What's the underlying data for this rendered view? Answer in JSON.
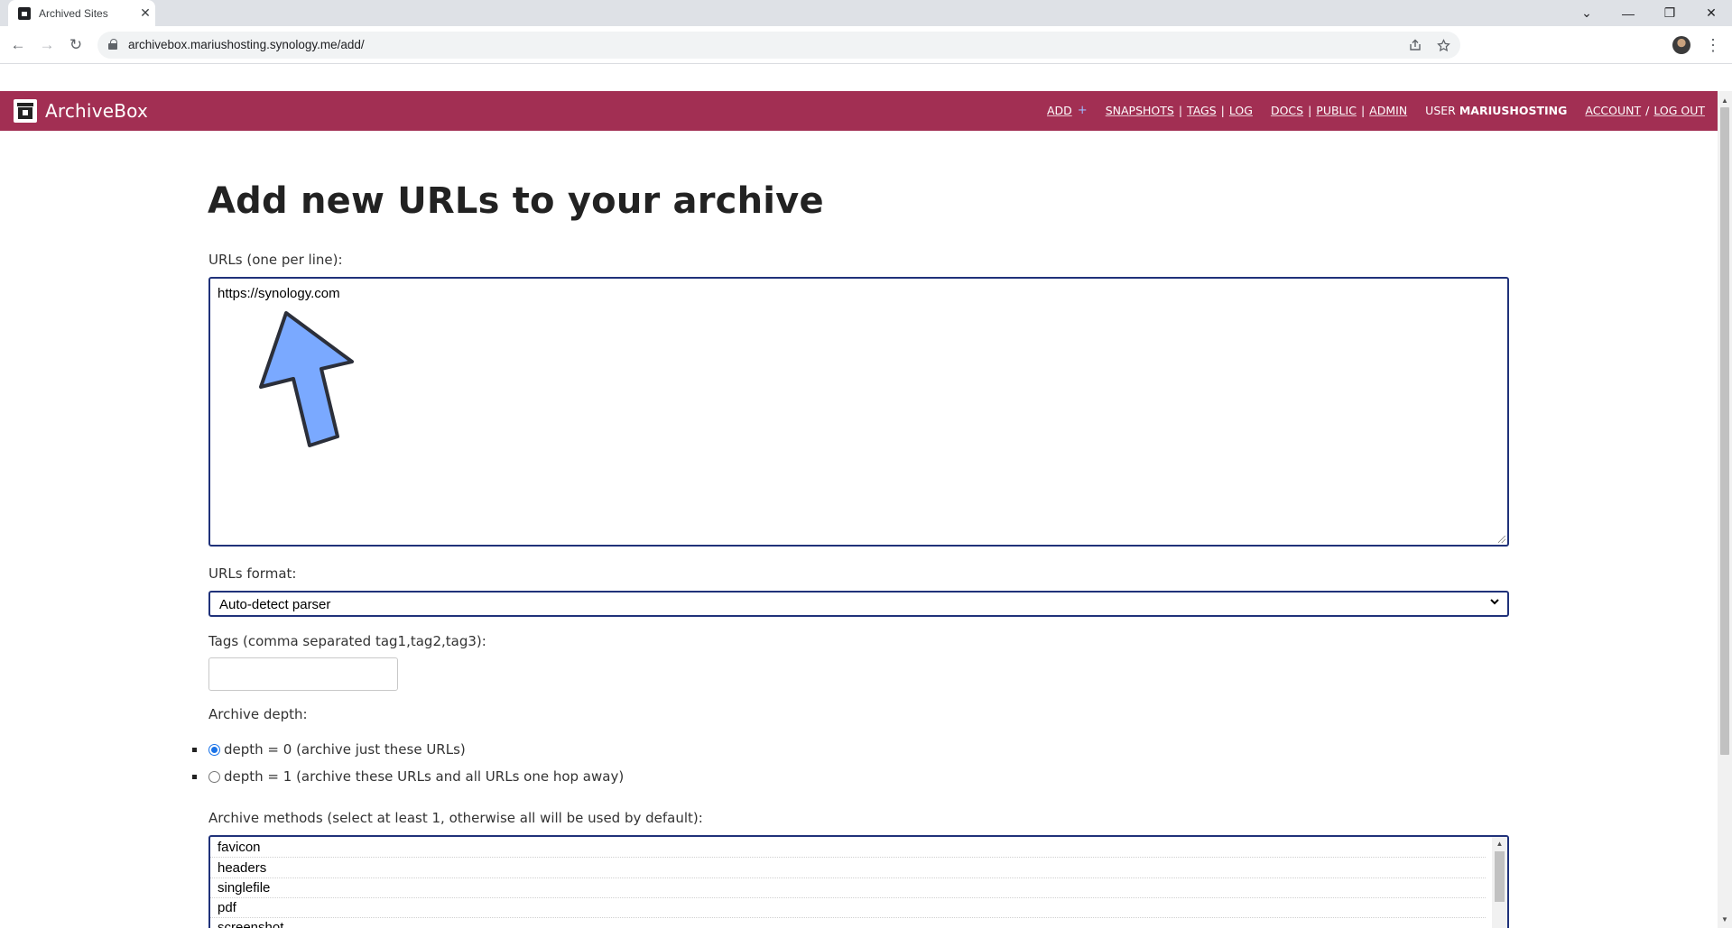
{
  "browser": {
    "tab_title": "Archived Sites",
    "tab_close": "✕",
    "url": "archivebox.mariushosting.synology.me/add/",
    "window_controls": {
      "chevron": "⌄",
      "minimize": "—",
      "restore": "❐",
      "close": "✕"
    },
    "nav": {
      "back": "←",
      "forward": "→",
      "reload": "↻"
    },
    "icons": [
      "lock-icon",
      "share-icon",
      "star-icon",
      "profile-avatar",
      "kebab-menu-icon"
    ]
  },
  "app": {
    "name": "ArchiveBox",
    "header_color": "#a22f53",
    "nav": {
      "add": "ADD",
      "add_plus": "+",
      "snapshots": "SNAPSHOTS",
      "tags": "TAGS",
      "log": "LOG",
      "docs": "DOCS",
      "public": "PUBLIC",
      "admin": "ADMIN",
      "user_prefix": "USER",
      "username": "MARIUSHOSTING",
      "account": "ACCOUNT",
      "logout": "LOG OUT",
      "pipe": "|",
      "slash": "/"
    }
  },
  "form": {
    "title": "Add new URLs to your archive",
    "urls_label": "URLs (one per line):",
    "urls_value": "https://synology.com",
    "format_label": "URLs format:",
    "format_value": "Auto-detect parser",
    "tags_label": "Tags (comma separated tag1,tag2,tag3):",
    "tags_value": "",
    "depth_label": "Archive depth:",
    "depth_options": [
      {
        "label": "depth = 0 (archive just these URLs)",
        "checked": true
      },
      {
        "label": "depth = 1 (archive these URLs and all URLs one hop away)",
        "checked": false
      }
    ],
    "methods_label": "Archive methods (select at least 1, otherwise all will be used by default):",
    "methods": [
      "favicon",
      "headers",
      "singlefile",
      "pdf",
      "screenshot"
    ]
  },
  "colors": {
    "focus_border": "#20327a",
    "arrow_fill": "#7aa9ff",
    "radio_checked": "#1a73e8"
  }
}
